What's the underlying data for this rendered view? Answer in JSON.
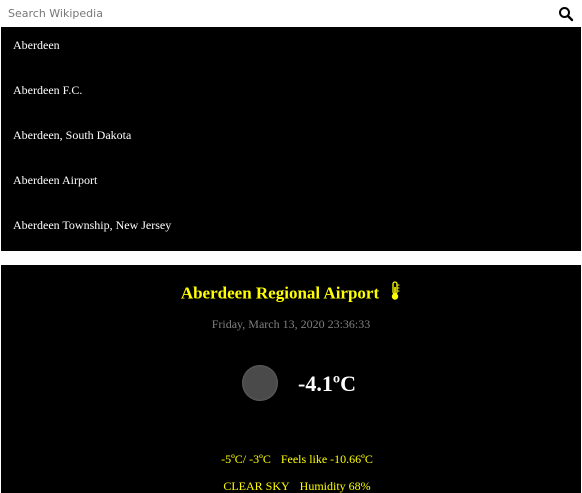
{
  "search": {
    "placeholder": "Search Wikipedia",
    "value": ""
  },
  "suggestions": [
    "Aberdeen",
    "Aberdeen F.C.",
    "Aberdeen, South Dakota",
    "Aberdeen Airport",
    "Aberdeen Township, New Jersey"
  ],
  "weather": {
    "location": "Aberdeen Regional Airport",
    "datetime": "Friday, March 13, 2020 23:36:33",
    "temperature": "-4.1ºC",
    "min_max": "-5ºC/ -3ºC",
    "feels_like": "Feels like -10.66ºC",
    "condition": "CLEAR SKY",
    "humidity": "Humidity 68%"
  },
  "colors": {
    "background": "#000000",
    "accent": "#ffff00",
    "muted": "#7f7f7f",
    "text": "#ffffff"
  },
  "icons": {
    "search": "search-icon",
    "title": "thermometer-icon",
    "condition": "weather-condition-icon"
  }
}
